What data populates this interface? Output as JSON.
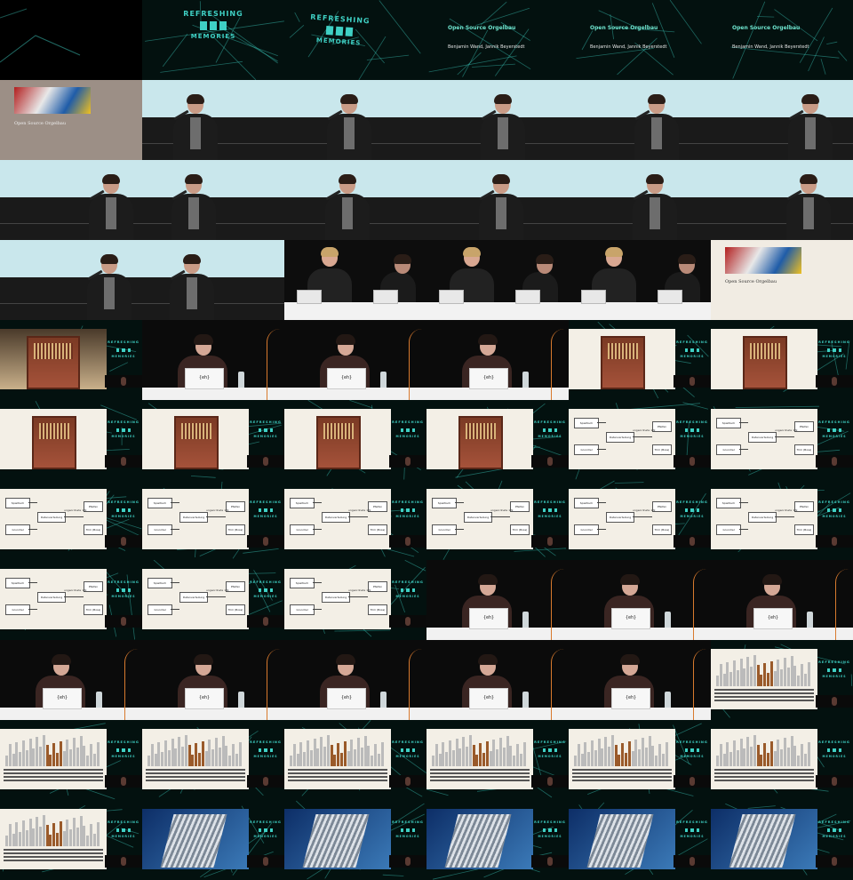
{
  "logo": {
    "top": "REFRESHING",
    "bottom": "MEMORIES"
  },
  "talk": {
    "title": "Open Source Orgelbau",
    "authors": "Benjamin Wand, Jannik Beyerstedt",
    "serif_title": "Open Source Orgelbau"
  },
  "laptop_mark": "{eh}",
  "diagram": {
    "spieltisch": "Spieltisch",
    "datenverteilung": "Datenverteilung",
    "pfeifen": "Pfeifen",
    "ansteuerung": "ungeordnete 1:N",
    "grund": "Grundrel",
    "trim": "Trim (Boss)"
  },
  "colors": {
    "accent": "#3fd0c4",
    "neon": "#03110f",
    "wood": "#a5523a"
  },
  "cells": [
    "neon-edge",
    "logo",
    "logo-tilt",
    "title",
    "title",
    "title",
    "lego-title",
    "speaker",
    "speaker",
    "speaker",
    "speaker",
    "speaker",
    "speaker",
    "speaker",
    "speaker",
    "speaker",
    "speaker",
    "speaker",
    "speaker",
    "speaker",
    "panel",
    "panel",
    "panel",
    "lego-slide",
    "cathedral",
    "desk",
    "desk",
    "desk",
    "organ",
    "organ",
    "organ",
    "organ",
    "organ",
    "organ",
    "diagram",
    "diagram",
    "diagram",
    "diagram",
    "diagram",
    "diagram",
    "diagram",
    "diagram",
    "diagram",
    "diagram",
    "diagram",
    "desk",
    "desk",
    "desk",
    "desk",
    "desk",
    "desk",
    "desk",
    "desk",
    "bars",
    "bars",
    "bars",
    "bars",
    "bars",
    "bars",
    "bars",
    "bars",
    "building",
    "building",
    "building",
    "building",
    "building"
  ]
}
